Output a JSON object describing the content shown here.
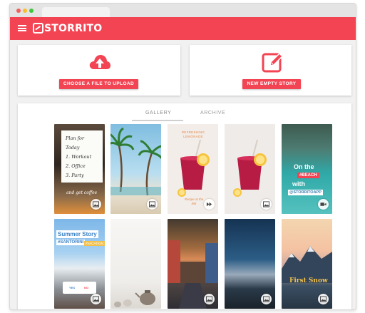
{
  "app": {
    "name": "STORRITO",
    "accent": "#f34453"
  },
  "upload_card": {
    "button_label": "CHOOSE A FILE TO UPLOAD",
    "icon": "cloud-upload-icon"
  },
  "story_card": {
    "button_label": "NEW EMPTY STORY",
    "icon": "edit-icon"
  },
  "gallery": {
    "tabs": [
      {
        "label": "GALLERY",
        "active": true
      },
      {
        "label": "ARCHIVE",
        "active": false
      }
    ],
    "items": [
      {
        "type": "image",
        "text": {
          "title": "Plan for Today",
          "list": [
            "1. Workout",
            "2. Office",
            "3. Party"
          ],
          "caption": "and get coffee"
        }
      },
      {
        "type": "image"
      },
      {
        "type": "video",
        "text": {
          "top": "REFRESHING LEMONADE",
          "bottom": "Recipe at the link"
        }
      },
      {
        "type": "image"
      },
      {
        "type": "video",
        "text": {
          "line1": "On the",
          "tag1": "#BEACH",
          "line2": "with",
          "tag2": "@STORRITOAPP"
        }
      },
      {
        "type": "image",
        "text": {
          "title": "Summer Story",
          "tag": "#SANTORINI",
          "tag2": "#VACATION",
          "poll_yes": "YES",
          "poll_no": "NO"
        }
      },
      {
        "type": "image"
      },
      {
        "type": "image"
      },
      {
        "type": "image"
      },
      {
        "type": "image",
        "text": {
          "title": "First Snow"
        }
      }
    ]
  }
}
